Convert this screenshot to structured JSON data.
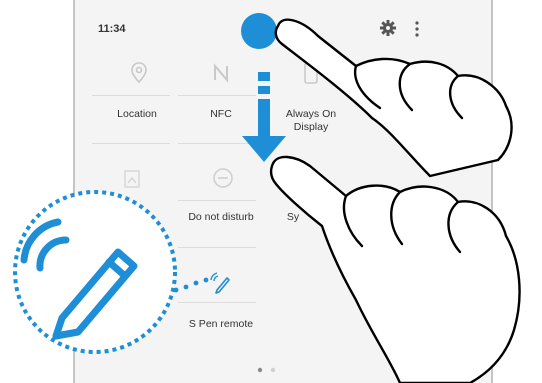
{
  "status_bar": {
    "time": "11:34",
    "settings_icon": "gear-icon",
    "more_icon": "more-vertical-icon"
  },
  "quick_panel": {
    "tiles": [
      {
        "label": "Location",
        "icon": "location-icon",
        "active": false
      },
      {
        "label": "NFC",
        "icon": "nfc-icon",
        "active": false
      },
      {
        "label": "Always On Display",
        "icon": "always-on-display-icon",
        "active": false
      },
      {
        "label": "",
        "icon": "screenshot-icon",
        "active": false
      },
      {
        "label": "Do not disturb",
        "icon": "do-not-disturb-icon",
        "active": false
      },
      {
        "label": "Sy",
        "icon": "sync-icon",
        "active": false
      },
      {
        "label": "S Pen remote",
        "icon": "s-pen-remote-icon",
        "active": false
      }
    ],
    "page_count": 2,
    "current_page": 1
  },
  "gesture": {
    "type": "swipe-down",
    "icon": "arrow-down-icon"
  },
  "callout": {
    "icon": "s-pen-remote-icon"
  },
  "colors": {
    "accent": "#1e8ed6",
    "background": "#f4f4f4",
    "label": "#333333",
    "icon_inactive": "#bdbdbd"
  }
}
